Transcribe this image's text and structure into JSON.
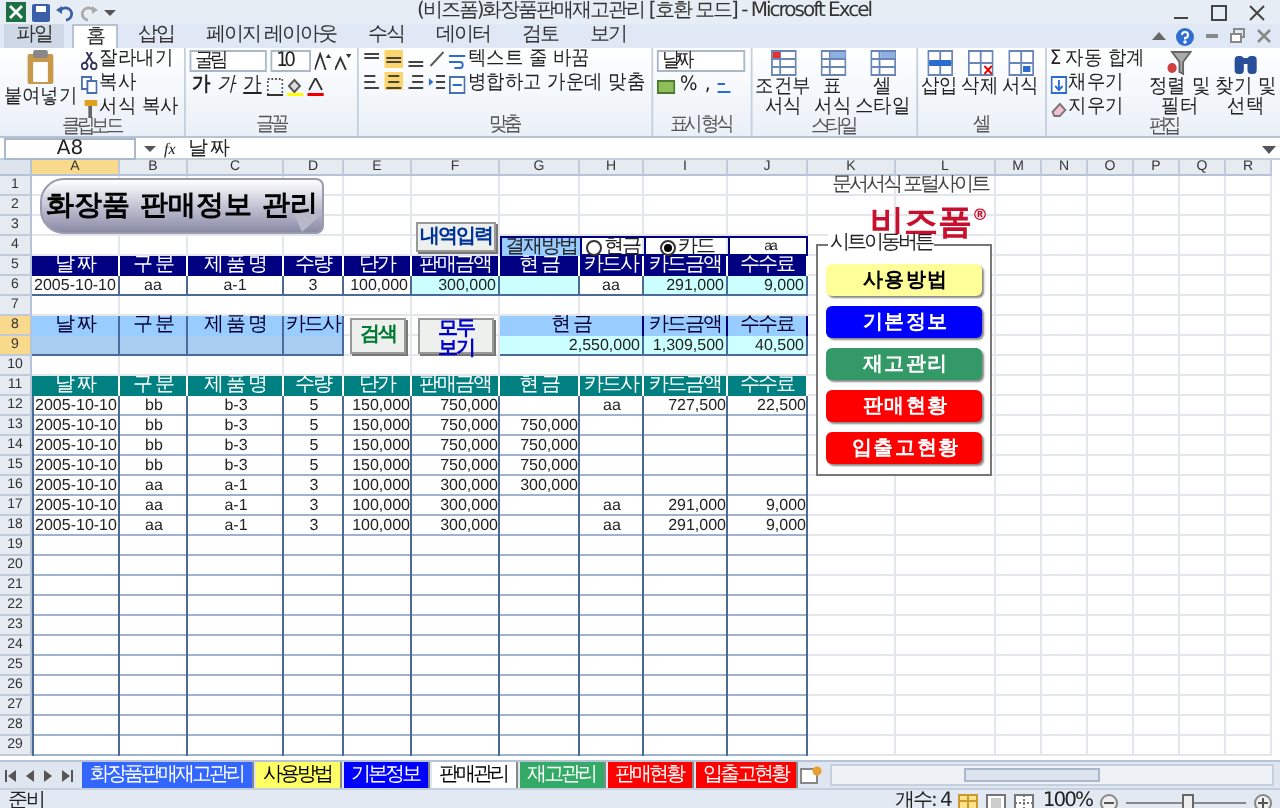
{
  "title_bar": {
    "title": "(비즈폼)화장품판매재고관리 [호환 모드] - Microsoft Excel"
  },
  "ribbon_tabs": [
    {
      "label": "파일",
      "kind": "file",
      "selected": false
    },
    {
      "label": "홈",
      "kind": "tab",
      "selected": true
    },
    {
      "label": "삽입",
      "kind": "tab",
      "selected": false
    },
    {
      "label": "페이지 레이아웃",
      "kind": "tab",
      "selected": false
    },
    {
      "label": "수식",
      "kind": "tab",
      "selected": false
    },
    {
      "label": "데이터",
      "kind": "tab",
      "selected": false
    },
    {
      "label": "검토",
      "kind": "tab",
      "selected": false
    },
    {
      "label": "보기",
      "kind": "tab",
      "selected": false
    }
  ],
  "clipboard": {
    "paste": "붙여넣기",
    "cut": "잘라내기",
    "copy": "복사",
    "format_painter": "서식 복사",
    "group": "클립보드"
  },
  "font": {
    "family": "굴림",
    "size": "10",
    "bold": "가",
    "italic": "가",
    "underline": "가",
    "group": "글꼴"
  },
  "alignment": {
    "wrap_text": "텍스트 줄 바꿈",
    "merge": "병합하고 가운데 맞춤",
    "group": "맞춤"
  },
  "number": {
    "format": "날짜",
    "percent": "%",
    "comma": ",",
    "group": "표시 형식"
  },
  "styles": {
    "buttons": [
      "조건부 서식",
      "표 서식",
      "셀 스타일"
    ],
    "group": "스타일"
  },
  "cells": {
    "buttons": [
      "삽입",
      "삭제",
      "서식"
    ],
    "group": "셀"
  },
  "editing": {
    "autosum_symbol": "Σ",
    "autosum": "자동 합계",
    "fill": "채우기",
    "clear": "지우기",
    "sort": "정렬 및 필터",
    "find": "찾기 및 선택",
    "group": "편집"
  },
  "formula_bar": {
    "name_box": "A8",
    "function_symbol": "fx",
    "content": "날 짜"
  },
  "column_headers": [
    {
      "label": "A",
      "selected": true
    },
    {
      "label": "B",
      "selected": false
    },
    {
      "label": "C",
      "selected": false
    },
    {
      "label": "D",
      "selected": false
    },
    {
      "label": "E",
      "selected": false
    },
    {
      "label": "F",
      "selected": false
    },
    {
      "label": "G",
      "selected": false
    },
    {
      "label": "H",
      "selected": false
    },
    {
      "label": "I",
      "selected": false
    },
    {
      "label": "J",
      "selected": false
    },
    {
      "label": "K",
      "selected": false
    },
    {
      "label": "L",
      "selected": false
    },
    {
      "label": "M",
      "selected": false
    },
    {
      "label": "N",
      "selected": false
    },
    {
      "label": "O",
      "selected": false
    },
    {
      "label": "P",
      "selected": false
    },
    {
      "label": "Q",
      "selected": false
    },
    {
      "label": "R",
      "selected": false
    }
  ],
  "row_headers": [
    {
      "label": "1",
      "selected": false
    },
    {
      "label": "2",
      "selected": false
    },
    {
      "label": "3",
      "selected": false
    },
    {
      "label": "4",
      "selected": false
    },
    {
      "label": "5",
      "selected": false
    },
    {
      "label": "6",
      "selected": false
    },
    {
      "label": "7",
      "selected": false
    },
    {
      "label": "8",
      "selected": true
    },
    {
      "label": "9",
      "selected": true
    },
    {
      "label": "10",
      "selected": false
    },
    {
      "label": "11",
      "selected": false
    },
    {
      "label": "12",
      "selected": false
    },
    {
      "label": "13",
      "selected": false
    },
    {
      "label": "14",
      "selected": false
    },
    {
      "label": "15",
      "selected": false
    },
    {
      "label": "16",
      "selected": false
    },
    {
      "label": "17",
      "selected": false
    },
    {
      "label": "18",
      "selected": false
    },
    {
      "label": "19",
      "selected": false
    },
    {
      "label": "20",
      "selected": false
    },
    {
      "label": "21",
      "selected": false
    },
    {
      "label": "22",
      "selected": false
    },
    {
      "label": "23",
      "selected": false
    },
    {
      "label": "24",
      "selected": false
    },
    {
      "label": "25",
      "selected": false
    },
    {
      "label": "26",
      "selected": false
    },
    {
      "label": "27",
      "selected": false
    },
    {
      "label": "28",
      "selected": false
    },
    {
      "label": "29",
      "selected": false
    }
  ],
  "banner": {
    "title": "화장품 판매정보 관리"
  },
  "entry_button": "내역입력",
  "payment": {
    "label": "결재방법",
    "options": [
      {
        "label": "현금",
        "selected": false
      },
      {
        "label": "카드",
        "selected": true
      }
    ],
    "card_company": "aa"
  },
  "entry_table": {
    "columns": [
      "날 짜",
      "구 분",
      "제 품 명",
      "수량",
      "단가",
      "판매금액",
      "현 금",
      "카드사",
      "카드금액",
      "수수료"
    ],
    "values": {
      "date": "2005-10-10",
      "type": "aa",
      "product": "a-1",
      "qty": "3",
      "price": "100,000",
      "amount": "300,000",
      "card_company": "aa",
      "card_amount": "291,000",
      "fee": "9,000"
    }
  },
  "search": {
    "columns": [
      "날 짜",
      "구 분",
      "제 품 명",
      "카드사"
    ],
    "search_button": "검색",
    "show_all_button": "모두 보기",
    "summary_columns": [
      "현 금",
      "카드금액",
      "수수료"
    ],
    "summary_values": [
      "2,550,000",
      "1,309,500",
      "40,500"
    ]
  },
  "list_table": {
    "columns": [
      "날 짜",
      "구 분",
      "제 품 명",
      "수량",
      "단가",
      "판매금액",
      "현 금",
      "카드사",
      "카드금액",
      "수수료"
    ],
    "rows": [
      {
        "date": "2005-10-10",
        "type": "bb",
        "product": "b-3",
        "qty": "5",
        "price": "150,000",
        "amount": "750,000",
        "card_company": "aa",
        "card_amount": "727,500",
        "fee": "22,500"
      },
      {
        "date": "2005-10-10",
        "type": "bb",
        "product": "b-3",
        "qty": "5",
        "price": "150,000",
        "amount": "750,000",
        "cash": "750,000"
      },
      {
        "date": "2005-10-10",
        "type": "bb",
        "product": "b-3",
        "qty": "5",
        "price": "150,000",
        "amount": "750,000",
        "cash": "750,000"
      },
      {
        "date": "2005-10-10",
        "type": "bb",
        "product": "b-3",
        "qty": "5",
        "price": "150,000",
        "amount": "750,000",
        "cash": "750,000"
      },
      {
        "date": "2005-10-10",
        "type": "aa",
        "product": "a-1",
        "qty": "3",
        "price": "100,000",
        "amount": "300,000",
        "cash": "300,000"
      },
      {
        "date": "2005-10-10",
        "type": "aa",
        "product": "a-1",
        "qty": "3",
        "price": "100,000",
        "amount": "300,000",
        "card_company": "aa",
        "card_amount": "291,000",
        "fee": "9,000"
      },
      {
        "date": "2005-10-10",
        "type": "aa",
        "product": "a-1",
        "qty": "3",
        "price": "100,000",
        "amount": "300,000",
        "card_company": "aa",
        "card_amount": "291,000",
        "fee": "9,000"
      }
    ]
  },
  "logo": {
    "name": "비즈폼",
    "mark": "®",
    "tagline": "문서서식 포털사이트"
  },
  "nav_panel": {
    "title": "시트이동버튼",
    "buttons": [
      {
        "label": "사 용 방 법",
        "color": "#ffff99"
      },
      {
        "label": "기 본 정 보",
        "color": "#0000ff"
      },
      {
        "label": "재 고 관 리",
        "color": "#339966"
      },
      {
        "label": "판 매 현 황",
        "color": "#ff0000"
      },
      {
        "label": "입 출 고 현 황",
        "color": "#ff0000"
      }
    ]
  },
  "sheet_tabs": [
    {
      "label": "화장품판매재고관리",
      "color": "#3366ff",
      "selected": false
    },
    {
      "label": "사용방법",
      "color": "#ffff66",
      "selected": false
    },
    {
      "label": "기본정보",
      "color": "#0000ff",
      "selected": false
    },
    {
      "label": "판매관리",
      "selected": true
    },
    {
      "label": "재고관리",
      "color": "#33aa66",
      "selected": false
    },
    {
      "label": "판매현황",
      "color": "#ff0000",
      "selected": false
    },
    {
      "label": "입출고현황",
      "color": "#ff0000",
      "selected": false
    }
  ],
  "status_bar": {
    "ready": "준비",
    "count": "개수: 4",
    "zoom": "100%",
    "zoom_slider": {
      "level": 0.5
    }
  }
}
